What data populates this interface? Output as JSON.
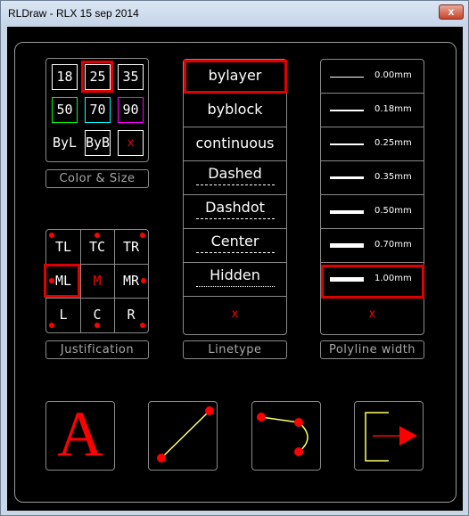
{
  "window": {
    "title": "RLDraw - RLX 15 sep 2014",
    "close_glyph": "x"
  },
  "color_size": {
    "buttons": [
      {
        "label": "18",
        "color": "#ffffff",
        "selected": false
      },
      {
        "label": "25",
        "color": "#ffffff",
        "selected": true
      },
      {
        "label": "35",
        "color": "#ffffff",
        "selected": false
      },
      {
        "label": "50",
        "color": "#00ff00",
        "selected": false
      },
      {
        "label": "70",
        "color": "#00ffff",
        "selected": false
      },
      {
        "label": "90",
        "color": "#ff00ff",
        "selected": false
      },
      {
        "label": "ByL",
        "color": "#ffffff",
        "selected": false
      },
      {
        "label": "ByB",
        "color": "#ffffff",
        "selected": false
      },
      {
        "label": "x",
        "color": "#ff0000",
        "selected": false
      }
    ],
    "caption": "Color & Size"
  },
  "justification": {
    "cells": [
      "TL",
      "TC",
      "TR",
      "ML",
      "M",
      "MR",
      "L",
      "C",
      "R"
    ],
    "selected": "ML",
    "caption": "Justification"
  },
  "linetype": {
    "items": [
      {
        "label": "bylayer",
        "selected": true
      },
      {
        "label": "byblock",
        "selected": false
      },
      {
        "label": "continuous",
        "selected": false
      },
      {
        "label": "Dashed",
        "selected": false
      },
      {
        "label": "Dashdot",
        "selected": false
      },
      {
        "label": "Center",
        "selected": false
      },
      {
        "label": "Hidden",
        "selected": false
      }
    ],
    "clear_label": "x",
    "caption": "Linetype"
  },
  "polyline_width": {
    "items": [
      {
        "label": "0.00mm",
        "selected": false
      },
      {
        "label": "0.18mm",
        "selected": false
      },
      {
        "label": "0.25mm",
        "selected": false
      },
      {
        "label": "0.35mm",
        "selected": false
      },
      {
        "label": "0.50mm",
        "selected": false
      },
      {
        "label": "0.70mm",
        "selected": false
      },
      {
        "label": "1.00mm",
        "selected": true
      }
    ],
    "clear_label": "x",
    "caption": "Polyline width"
  },
  "tools": {
    "text_glyph": "A",
    "icons": [
      "text-tool-icon",
      "line-tool-icon",
      "polyline-tool-icon",
      "exit-icon"
    ]
  },
  "colors": {
    "accent_red": "#ff0000",
    "selection": "#e00000",
    "yellow": "#ffff66"
  }
}
